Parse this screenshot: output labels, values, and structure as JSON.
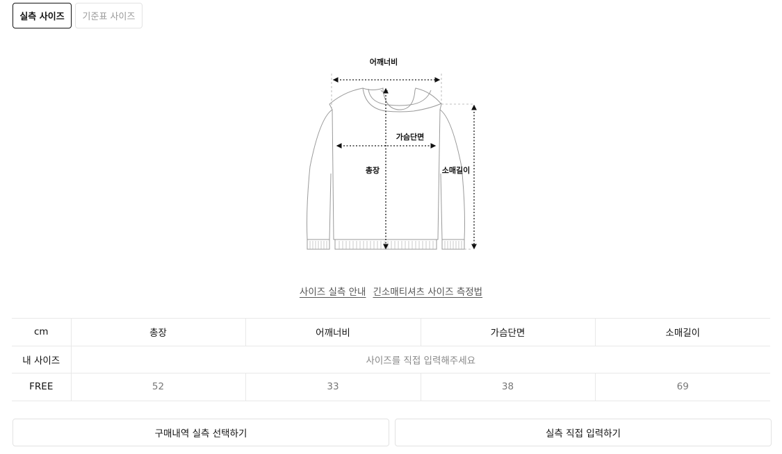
{
  "tabs": [
    {
      "label": "실측 사이즈",
      "active": true
    },
    {
      "label": "기준표 사이즈",
      "active": false
    }
  ],
  "diagram": {
    "shoulder_label": "어깨너비",
    "chest_label": "가슴단면",
    "length_label": "총장",
    "sleeve_label": "소매길이"
  },
  "links": [
    "사이즈 실측 안내",
    "긴소매티셔츠 사이즈 측정법"
  ],
  "table": {
    "unit": "cm",
    "headers": [
      "총장",
      "어깨너비",
      "가슴단면",
      "소매길이"
    ],
    "my_size": {
      "label": "내 사이즈",
      "placeholder": "사이즈를 직접 입력해주세요"
    },
    "rows": [
      {
        "size": "FREE",
        "values": [
          "52",
          "33",
          "38",
          "69"
        ]
      }
    ]
  },
  "actions": {
    "select_history": "구매내역 실측 선택하기",
    "direct_input": "실측 직접 입력하기"
  }
}
